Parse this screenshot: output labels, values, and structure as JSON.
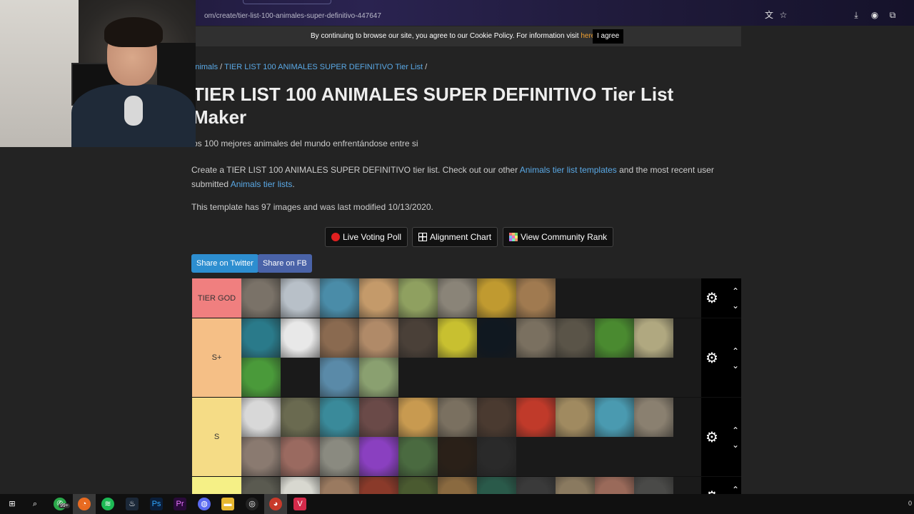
{
  "browser": {
    "url": "om/create/tier-list-100-animales-super-definitivo-447647"
  },
  "cookie": {
    "message": "By continuing to browse our site, you agree to our Cookie Policy. For information visit ",
    "link_text": "here",
    "suffix": ".",
    "agree_label": "I agree"
  },
  "breadcrumb": {
    "category": "Animals",
    "sep1": " / ",
    "current": "TIER LIST 100 ANIMALES SUPER DEFINITIVO Tier List",
    "sep2": " /"
  },
  "page": {
    "title": "TIER LIST 100 ANIMALES SUPER DEFINITIVO Tier List Maker",
    "description": "os 100 mejores animales del mundo enfrentándose entre si",
    "para_start": "Create a TIER LIST 100 ANIMALES SUPER DEFINITIVO tier list. Check out our other ",
    "para_link1": "Animals tier list templates",
    "para_mid": " and the most recent user submitted ",
    "para_link2": "Animals tier lists",
    "para_end": ".",
    "meta": "This template has 97 images and was last modified 10/13/2020."
  },
  "tools": {
    "live_voting": "Live Voting Poll",
    "alignment": "Alignment Chart",
    "community_rank": "View Community Rank"
  },
  "share": {
    "twitter": "Share on Twitter",
    "facebook": "Share on FB"
  },
  "tiers": [
    {
      "label": "TIER GOD",
      "color": "#f07f7f",
      "rows": 1,
      "tiles": [
        "#7a7268",
        "#b8c0c8",
        "#4a8ca8",
        "#c49a6a",
        "#8fa060",
        "#8a8478",
        "#c09a30",
        "#a07a50"
      ]
    },
    {
      "label": "S+",
      "color": "#f5bf86",
      "rows": 2,
      "tiles": [
        "#2a7a8a",
        "#e8e8e8",
        "#8a6a50",
        "#b08a68",
        "#4a4038",
        "#c8c030",
        "#101820",
        "#7a7060",
        "#5a5448",
        "#4a8a30",
        "#b0a880",
        "#4a9a3a",
        "#1a1a1a",
        "#5a8aa8",
        "#8aa070"
      ]
    },
    {
      "label": "S",
      "color": "#f5dc86",
      "rows": 2,
      "tiles": [
        "#d8d8d8",
        "#6a6a50",
        "#3a8a9a",
        "#6a4a48",
        "#c89a50",
        "#7a7060",
        "#4a3a30",
        "#c03a2a",
        "#a08a60",
        "#4a9ab0",
        "#8a8070",
        "#8a7a70",
        "#9a6a60",
        "#8a8a80",
        "#8a40c0",
        "#4a6a40",
        "#2a2018",
        "#2a2a2a"
      ]
    },
    {
      "label": "",
      "color": "#f5f086",
      "rows": 1,
      "tiles": [
        "#5a5a50",
        "#d8d8d0",
        "#9a7a60",
        "#8a3a2a",
        "#4a5a30",
        "#8a6a40",
        "#2a5a4a",
        "#3a3a3a",
        "#8a7a60",
        "#9a6a5a",
        "#4a4a48"
      ]
    }
  ],
  "icons": {
    "gear": "⚙",
    "up": "⌃",
    "down": "⌄"
  },
  "taskbar": {
    "badge": "99+",
    "time": "0"
  }
}
